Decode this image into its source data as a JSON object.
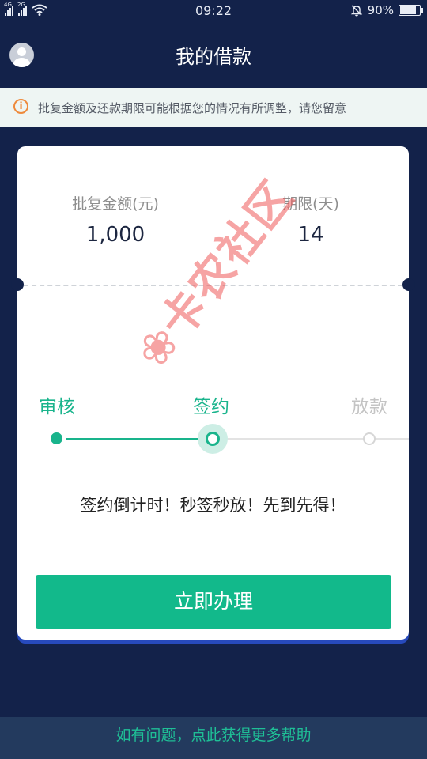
{
  "status_bar": {
    "signal_1": "4G",
    "signal_2": "2G",
    "time": "09:22",
    "battery": "90%",
    "battery_level": 0.9,
    "icons": [
      "signal-icon",
      "wifi-icon",
      "mute-bell-icon",
      "battery-icon"
    ]
  },
  "header": {
    "title": "我的借款",
    "avatar_icon": "user-avatar-icon"
  },
  "notice": {
    "icon": "info-icon",
    "icon_glyph": "i",
    "text": "批复金额及还款期限可能根据您的情况有所调整，请您留意"
  },
  "loan": {
    "amount_label": "批复金额(元)",
    "amount_value": "1,000",
    "term_label": "期限(天)",
    "term_value": "14"
  },
  "steps": [
    {
      "label": "审核",
      "state": "done"
    },
    {
      "label": "签约",
      "state": "current"
    },
    {
      "label": "放款",
      "state": "pending"
    }
  ],
  "promo_text": "签约倒计时！秒签秒放！先到先得！",
  "apply_button": "立即办理",
  "watermark": "卡农社区",
  "footer": {
    "help_link": "如有问题，点此获得更多帮助"
  },
  "colors": {
    "background": "#13224a",
    "accent": "#12b98b",
    "notice_icon": "#ee8a3c"
  }
}
